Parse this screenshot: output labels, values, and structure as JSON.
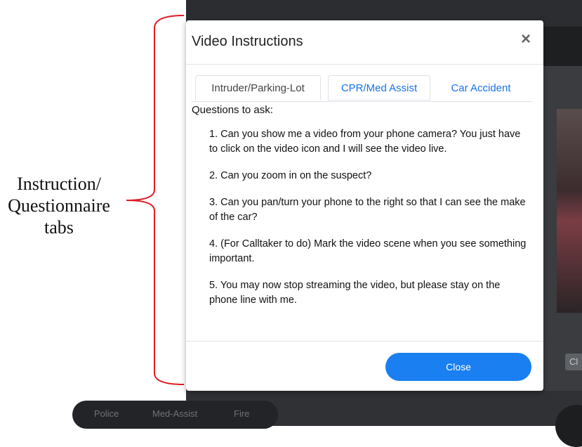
{
  "annotation": {
    "lines": [
      "Instruction/",
      "Questionnaire",
      "tabs"
    ],
    "bracket_color": "#e01b24"
  },
  "background": {
    "bottom_buttons": [
      "Police",
      "Med-Assist",
      "Fire"
    ],
    "side_chip": "Cl"
  },
  "modal": {
    "title": "Video Instructions",
    "close_icon": "×",
    "tabs": [
      {
        "label": "Intruder/Parking-Lot",
        "active": true
      },
      {
        "label": "CPR/Med Assist",
        "active": false
      },
      {
        "label": "Car Accident",
        "active": false
      }
    ],
    "heading": "Questions to ask:",
    "questions": [
      "1. Can you show me a video from your phone camera? You just have to click on the video icon and I will see the video live.",
      "2. Can you zoom in on the suspect?",
      "3. Can you pan/turn your phone to the right so that I can see the make of the car?",
      "4. (For Calltaker to do) Mark the video scene when you see something important.",
      "5. You may now stop streaming the video, but please stay on the phone line with me."
    ],
    "close_button": "Close",
    "accent_color": "#1a7ff0"
  }
}
